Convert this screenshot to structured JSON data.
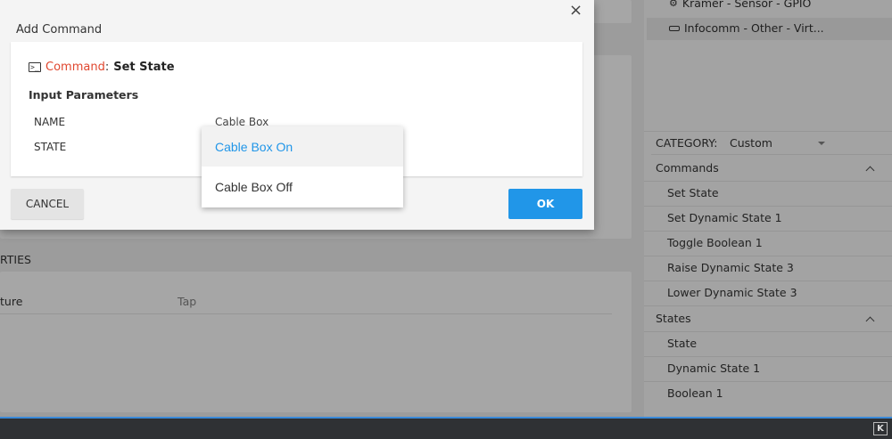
{
  "background": {
    "right_panel": {
      "top_items": [
        {
          "icon": "sensor-icon",
          "label": "Kramer - Sensor - GPIO"
        },
        {
          "icon": "device-icon",
          "label": "Infocomm - Other - Virt..."
        }
      ],
      "category_label": "CATEGORY:",
      "category_value": "Custom",
      "groups": [
        {
          "title": "Commands",
          "items": [
            "Set State",
            "Set Dynamic State 1",
            "Toggle Boolean 1",
            "Raise Dynamic State 3",
            "Lower Dynamic State 3"
          ]
        },
        {
          "title": "States",
          "items": [
            "State",
            "Dynamic State 1",
            "Boolean 1"
          ]
        }
      ]
    },
    "properties_header": "RTIES",
    "properties_row": {
      "label": "ture",
      "value": "Tap"
    }
  },
  "dialog": {
    "title": "Add Command",
    "close_symbol": "×",
    "command_label": "Command",
    "command_colon": ":",
    "command_value": "Set State",
    "input_parameters_title": "Input Parameters",
    "params": [
      {
        "name": "NAME",
        "value": "Cable Box"
      },
      {
        "name": "STATE",
        "value": ""
      }
    ],
    "cancel_label": "CANCEL",
    "ok_label": "OK"
  },
  "dropdown": {
    "options": [
      "Cable Box On",
      "Cable Box Off"
    ],
    "selected_index": 0
  },
  "colors": {
    "accent": "#2196e8",
    "command_label": "#e0472f"
  }
}
